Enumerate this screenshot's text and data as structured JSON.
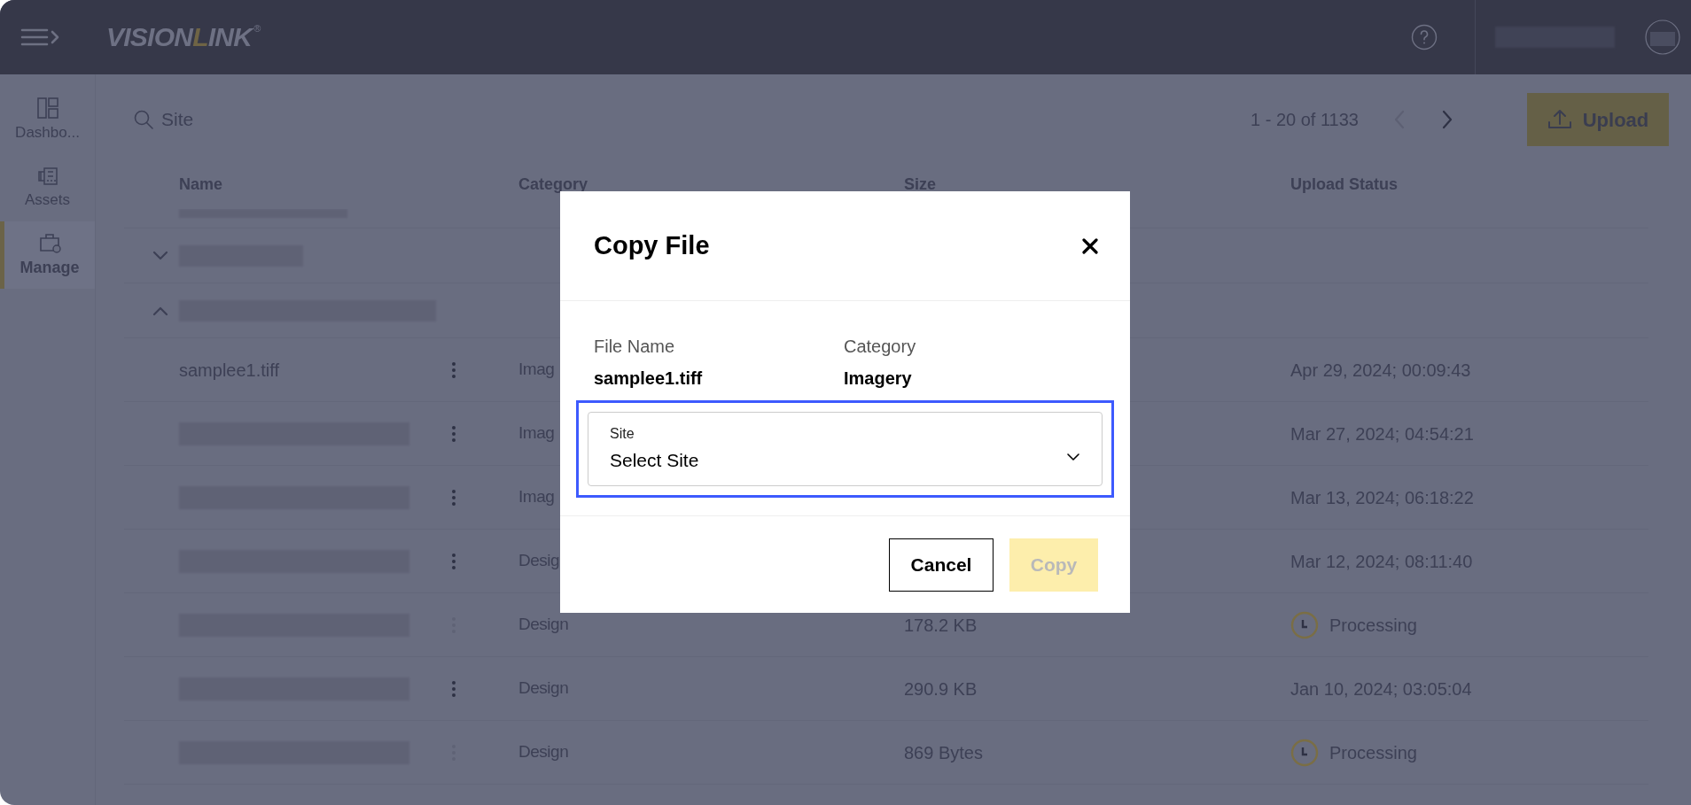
{
  "header": {
    "logo": {
      "parts": [
        "VISION",
        "L",
        "INK"
      ],
      "mark": "®"
    }
  },
  "sidebar": {
    "items": [
      {
        "label": "Dashbo...",
        "selected": false
      },
      {
        "label": "Assets",
        "selected": false
      },
      {
        "label": "Manage",
        "selected": true
      }
    ]
  },
  "toolbar": {
    "search": {
      "placeholder": "Site"
    },
    "pagination": {
      "range": "1 - 20 of 1133",
      "prev_disabled": true,
      "next_disabled": false
    },
    "upload_button": "Upload"
  },
  "table": {
    "columns": [
      "Name",
      "Category",
      "Size",
      "Upload Status"
    ],
    "rows": [
      {
        "kind": "partial"
      },
      {
        "kind": "group",
        "expanded": false
      },
      {
        "kind": "group",
        "expanded": true
      },
      {
        "kind": "file",
        "name": "samplee1.tiff",
        "menu_disabled": false,
        "category": "Imag",
        "status": {
          "kind": "date",
          "text": "Apr 29, 2024; 00:09:43"
        }
      },
      {
        "kind": "file",
        "menu_disabled": false,
        "category": "Imag",
        "status": {
          "kind": "date",
          "text": "Mar 27, 2024; 04:54:21"
        }
      },
      {
        "kind": "file",
        "menu_disabled": false,
        "category": "Imag",
        "status": {
          "kind": "date",
          "text": "Mar 13, 2024; 06:18:22"
        }
      },
      {
        "kind": "file",
        "menu_disabled": false,
        "category": "Desig",
        "status": {
          "kind": "date",
          "text": "Mar 12, 2024; 08:11:40"
        }
      },
      {
        "kind": "file",
        "menu_disabled": true,
        "category": "Design",
        "size": "178.2 KB",
        "status": {
          "kind": "processing",
          "text": "Processing"
        }
      },
      {
        "kind": "file",
        "menu_disabled": false,
        "category": "Design",
        "size": "290.9 KB",
        "status": {
          "kind": "date",
          "text": "Jan 10, 2024; 03:05:04"
        }
      },
      {
        "kind": "file",
        "menu_disabled": true,
        "category": "Design",
        "size": "869 Bytes",
        "status": {
          "kind": "processing",
          "text": "Processing"
        }
      }
    ]
  },
  "dialog": {
    "title": "Copy File",
    "fields": [
      {
        "label": "File Name",
        "value": "samplee1.tiff"
      },
      {
        "label": "Category",
        "value": "Imagery"
      }
    ],
    "site_select": {
      "label": "Site",
      "value": "Select Site",
      "focused": true
    },
    "buttons": [
      {
        "label": "Cancel",
        "kind": "secondary",
        "disabled": false
      },
      {
        "label": "Copy",
        "kind": "primary",
        "disabled": true
      }
    ]
  }
}
